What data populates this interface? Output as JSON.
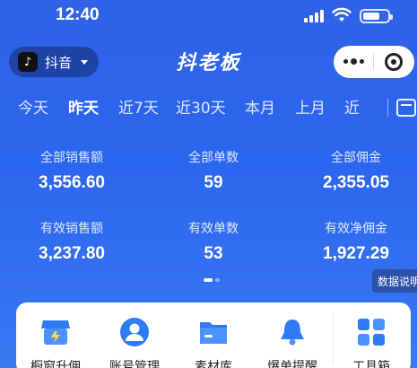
{
  "status_bar": {
    "time": "12:40"
  },
  "header": {
    "app_switch_label": "抖音",
    "title": "抖老板"
  },
  "tabs": [
    {
      "label": "今天"
    },
    {
      "label": "昨天"
    },
    {
      "label": "近7天"
    },
    {
      "label": "近30天"
    },
    {
      "label": "本月"
    },
    {
      "label": "上月"
    },
    {
      "label": "近"
    }
  ],
  "active_tab": "昨天",
  "metrics": [
    {
      "label": "全部销售额",
      "value": "3,556.60"
    },
    {
      "label": "全部单数",
      "value": "59"
    },
    {
      "label": "全部佣金",
      "value": "2,355.05"
    },
    {
      "label": "有效销售额",
      "value": "3,237.80"
    },
    {
      "label": "有效单数",
      "value": "53"
    },
    {
      "label": "有效净佣金",
      "value": "1,927.29"
    }
  ],
  "data_help_label": "数据说明",
  "pager": {
    "pages": 2,
    "current": 1
  },
  "tools": [
    {
      "label": "橱窗升佣",
      "icon": "storefront-icon"
    },
    {
      "label": "账号管理",
      "icon": "user-icon"
    },
    {
      "label": "素材库",
      "icon": "folder-icon"
    },
    {
      "label": "爆单提醒",
      "icon": "bell-icon"
    },
    {
      "label": "工具箱",
      "icon": "grid-icon"
    }
  ],
  "colors": {
    "background": "#2f62e6",
    "tool_icon_blue": "#2f7bf5",
    "card": "#ffffff"
  }
}
